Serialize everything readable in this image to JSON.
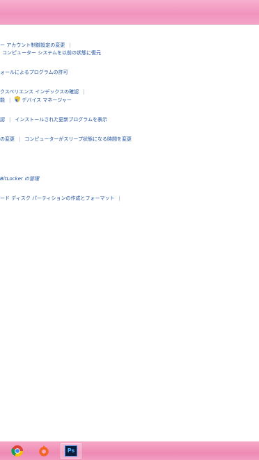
{
  "sections": {
    "user_accounts": {
      "uac_link": "ー アカウント制御設定の変更",
      "restore_link": "コンピューター システムを以前の状態に復元"
    },
    "firewall": {
      "allow_link": "ォールによるプログラムの許可"
    },
    "system": {
      "experience_link": "クスペリエンス インデックスの確認",
      "partial_link": "能",
      "device_manager_link": "デバイス マネージャー"
    },
    "windows_update": {
      "partial_link": "認",
      "installed_updates_link": "インストールされた更新プログラムを表示"
    },
    "power": {
      "partial_link": "の変更",
      "sleep_link": "コンピューターがスリープ状態になる時間を変更"
    },
    "bitlocker": {
      "manage_link": "BitLocker の管理"
    },
    "admin_tools": {
      "partition_link": "ード ディスク パーティションの作成とフォーマット"
    }
  },
  "separator": "|",
  "icons": {
    "shield": "uac-shield-icon",
    "taskbar": [
      "chrome-icon",
      "origin-icon",
      "photoshop-icon"
    ]
  },
  "taskbar": {
    "photoshop_label": "Ps"
  },
  "colors": {
    "link": "#1b4e9e",
    "title_bar": "#f193bd",
    "taskbar": "#ee8ab4"
  }
}
